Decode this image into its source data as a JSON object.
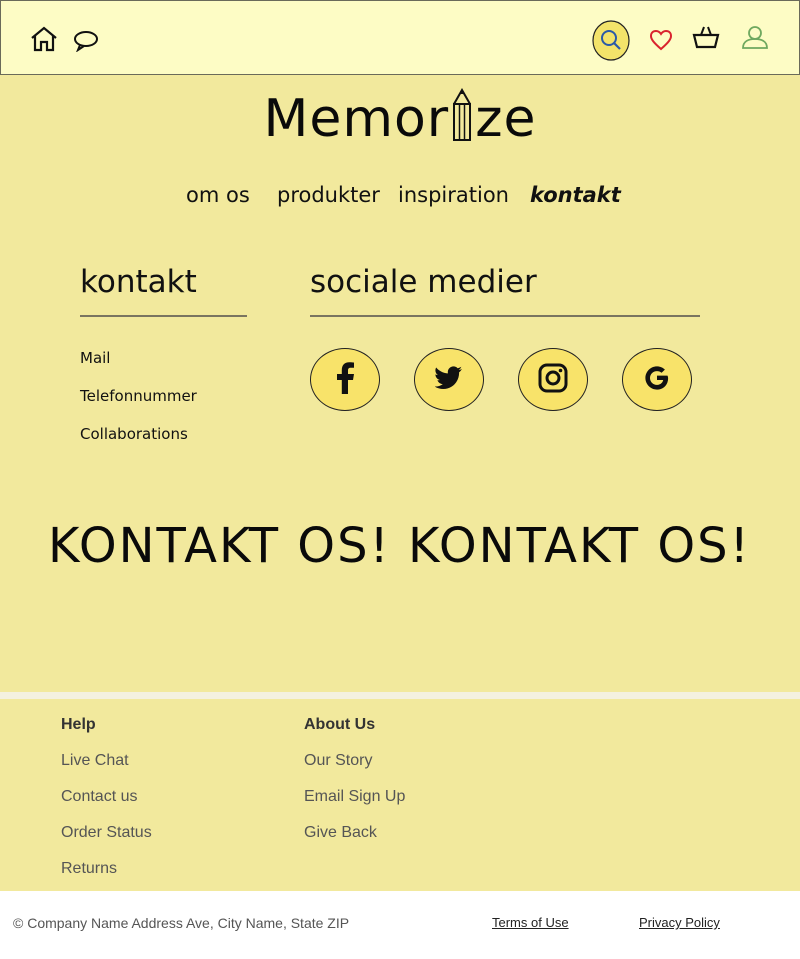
{
  "header": {
    "icons": [
      "home-icon",
      "chat-icon",
      "search-icon",
      "heart-icon",
      "basket-icon",
      "user-icon"
    ],
    "colors": {
      "bar": "#fdfcc5",
      "heart": "#d9232e",
      "search_ring": "#f3e36a",
      "user": "#6fa85f"
    }
  },
  "logo": {
    "before": "Memor",
    "after": "ze"
  },
  "nav": {
    "items": [
      "om os",
      "produkter",
      "inspiration",
      "kontakt"
    ],
    "active": "kontakt"
  },
  "contact": {
    "title": "kontakt",
    "links": [
      "Mail",
      "Telefonnummer",
      "Collaborations"
    ]
  },
  "social": {
    "title": "sociale medier",
    "icons": [
      "facebook-icon",
      "twitter-icon",
      "instagram-icon",
      "google-icon"
    ]
  },
  "marquee": {
    "text": "KONTAKT OS! KONTAKT OS! KO"
  },
  "footer": {
    "help": {
      "heading": "Help",
      "links": [
        "Live Chat",
        "Contact us",
        "Order Status",
        "Returns"
      ]
    },
    "about": {
      "heading": "About Us",
      "links": [
        "Our Story",
        "Email Sign Up",
        "Give Back"
      ]
    }
  },
  "bottom": {
    "copyright": "© Company Name Address Ave, City Name, State ZIP",
    "terms": "Terms of Use",
    "privacy": "Privacy Policy"
  },
  "colors": {
    "background": "#f2e99d",
    "social_fill": "#f8e36a"
  }
}
